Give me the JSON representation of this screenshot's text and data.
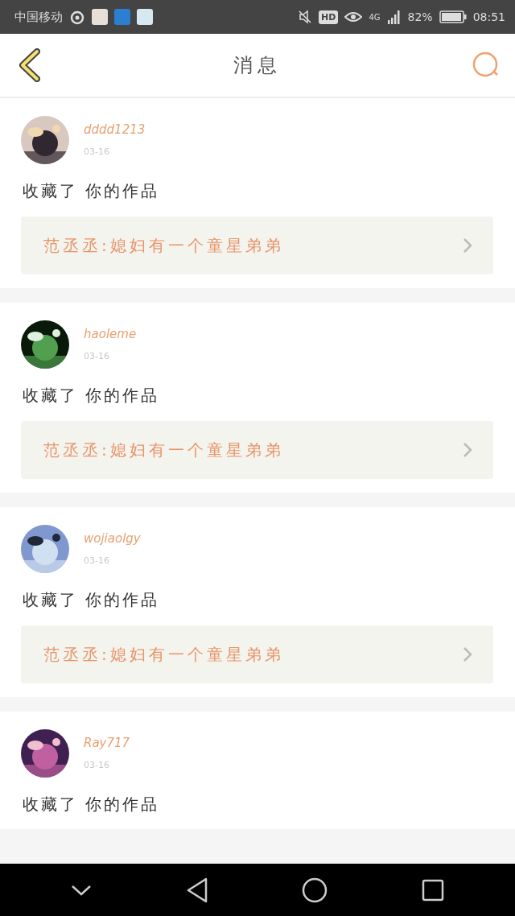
{
  "status_bar": {
    "carrier": "中国移动",
    "hd": "HD",
    "network": "4G",
    "battery": "82%",
    "time": "08:51"
  },
  "header": {
    "title": "消息"
  },
  "messages": [
    {
      "user": "dddd1213",
      "date": "03-16",
      "action": "收藏了 你的作品",
      "link": "范丞丞:媳妇有一个童星弟弟"
    },
    {
      "user": "haoleme",
      "date": "03-16",
      "action": "收藏了 你的作品",
      "link": "范丞丞:媳妇有一个童星弟弟"
    },
    {
      "user": "wojiaolgy",
      "date": "03-16",
      "action": "收藏了 你的作品",
      "link": "范丞丞:媳妇有一个童星弟弟"
    },
    {
      "user": "Ray717",
      "date": "03-16",
      "action": "收藏了 你的作品"
    }
  ]
}
